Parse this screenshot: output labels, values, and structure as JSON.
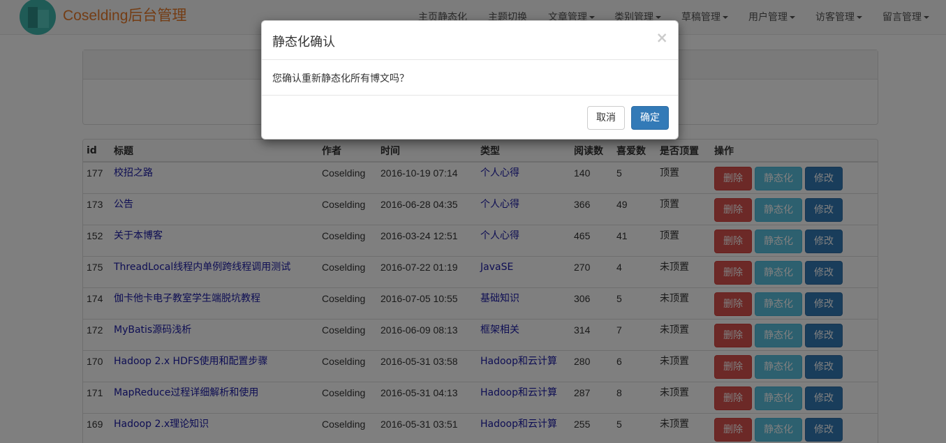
{
  "app": {
    "brand": "Coselding后台管理"
  },
  "nav": [
    {
      "label": "主页静态化",
      "dropdown": false
    },
    {
      "label": "主题切换",
      "dropdown": false
    },
    {
      "label": "文章管理",
      "dropdown": true
    },
    {
      "label": "类别管理",
      "dropdown": true
    },
    {
      "label": "草稿管理",
      "dropdown": true
    },
    {
      "label": "用户管理",
      "dropdown": true
    },
    {
      "label": "访客管理",
      "dropdown": true
    },
    {
      "label": "留言管理",
      "dropdown": true
    }
  ],
  "table": {
    "headers": [
      "id",
      "标题",
      "作者",
      "时间",
      "类型",
      "阅读数",
      "喜爱数",
      "是否顶置",
      "操作"
    ],
    "action_labels": {
      "delete": "删除",
      "static": "静态化",
      "edit": "修改"
    },
    "rows": [
      {
        "id": "177",
        "title": "校招之路",
        "author": "Coselding",
        "time": "2016-10-19 07:14",
        "type": "个人心得",
        "reads": "140",
        "likes": "5",
        "top": "顶置"
      },
      {
        "id": "173",
        "title": "公告",
        "author": "Coselding",
        "time": "2016-06-28 04:35",
        "type": "个人心得",
        "reads": "366",
        "likes": "49",
        "top": "顶置"
      },
      {
        "id": "152",
        "title": "关于本博客",
        "author": "Coselding",
        "time": "2016-03-24 12:51",
        "type": "个人心得",
        "reads": "465",
        "likes": "41",
        "top": "顶置"
      },
      {
        "id": "175",
        "title": "ThreadLocal线程内单例跨线程调用测试",
        "author": "Coselding",
        "time": "2016-07-22 01:19",
        "type": "JavaSE",
        "reads": "270",
        "likes": "4",
        "top": "未顶置"
      },
      {
        "id": "174",
        "title": "伽卡他卡电子教室学生端脱坑教程",
        "author": "Coselding",
        "time": "2016-07-05 10:55",
        "type": "基础知识",
        "reads": "306",
        "likes": "5",
        "top": "未顶置"
      },
      {
        "id": "172",
        "title": "MyBatis源码浅析",
        "author": "Coselding",
        "time": "2016-06-09 08:13",
        "type": "框架相关",
        "reads": "314",
        "likes": "7",
        "top": "未顶置"
      },
      {
        "id": "170",
        "title": "Hadoop 2.x HDFS使用和配置步骤",
        "author": "Coselding",
        "time": "2016-05-31 03:58",
        "type": "Hadoop和云计算",
        "reads": "280",
        "likes": "6",
        "top": "未顶置"
      },
      {
        "id": "171",
        "title": "MapReduce过程详细解析和使用",
        "author": "Coselding",
        "time": "2016-05-31 04:13",
        "type": "Hadoop和云计算",
        "reads": "287",
        "likes": "8",
        "top": "未顶置"
      },
      {
        "id": "169",
        "title": "Hadoop 2.x理论知识",
        "author": "Coselding",
        "time": "2016-05-31 03:51",
        "type": "Hadoop和云计算",
        "reads": "255",
        "likes": "5",
        "top": "未顶置"
      }
    ]
  },
  "modal": {
    "title": "静态化确认",
    "close": "×",
    "message": "您确认重新静态化所有博文吗？",
    "cancel": "取消",
    "confirm": "确定"
  },
  "colors": {
    "brand": "#e87b2a",
    "danger": "#d9534f",
    "info": "#5bc0de",
    "primary": "#337ab7",
    "link": "#1a1aa6"
  }
}
